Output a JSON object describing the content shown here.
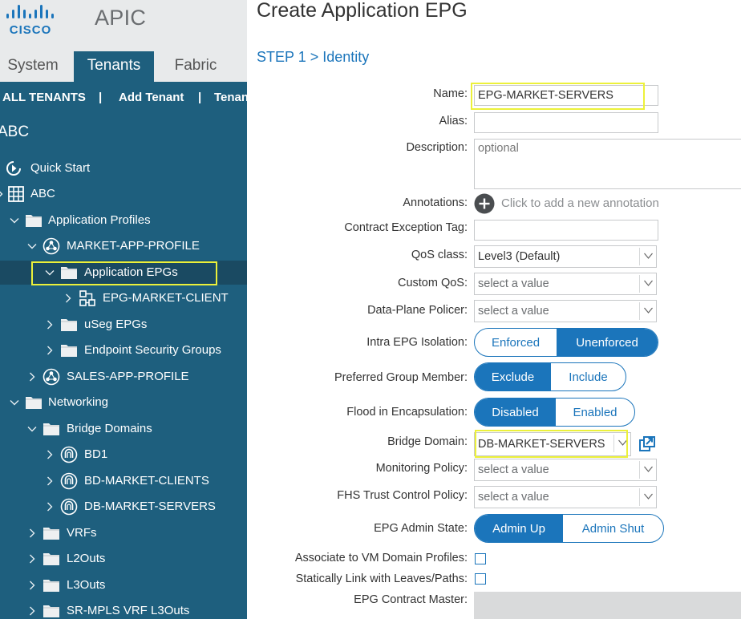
{
  "brand": {
    "logo_text": "CISCO",
    "app_name": "APIC"
  },
  "nav_tabs": {
    "system": "System",
    "tenants": "Tenants",
    "fabric": "Fabric"
  },
  "sub_nav": {
    "all_tenants": "ALL TENANTS",
    "separator": "|",
    "add_tenant": "Add Tenant",
    "tenant_search": "Tenan"
  },
  "tenant_title": "ABC",
  "tree": [
    {
      "label": "Quick Start",
      "icon": "quick-start-icon"
    },
    {
      "label": "ABC",
      "icon": "tenant-icon"
    },
    {
      "label": "Application Profiles",
      "icon": "folder-icon"
    },
    {
      "label": "MARKET-APP-PROFILE",
      "icon": "app-profile-icon"
    },
    {
      "label": "Application EPGs",
      "icon": "folder-icon",
      "selected": true
    },
    {
      "label": "EPG-MARKET-CLIENT",
      "icon": "epg-icon"
    },
    {
      "label": "uSeg EPGs",
      "icon": "folder-icon"
    },
    {
      "label": "Endpoint Security Groups",
      "icon": "folder-icon"
    },
    {
      "label": "SALES-APP-PROFILE",
      "icon": "app-profile-icon"
    },
    {
      "label": "Networking",
      "icon": "folder-icon"
    },
    {
      "label": "Bridge Domains",
      "icon": "folder-icon"
    },
    {
      "label": "BD1",
      "icon": "bridge-domain-icon"
    },
    {
      "label": "BD-MARKET-CLIENTS",
      "icon": "bridge-domain-icon"
    },
    {
      "label": "DB-MARKET-SERVERS",
      "icon": "bridge-domain-icon"
    },
    {
      "label": "VRFs",
      "icon": "folder-icon"
    },
    {
      "label": "L2Outs",
      "icon": "folder-icon"
    },
    {
      "label": "L3Outs",
      "icon": "folder-icon"
    },
    {
      "label": "SR-MPLS VRF L3Outs",
      "icon": "folder-icon"
    }
  ],
  "form": {
    "title": "Create Application EPG",
    "step": "STEP 1 > Identity",
    "name": {
      "label": "Name:",
      "value": "EPG-MARKET-SERVERS"
    },
    "alias": {
      "label": "Alias:",
      "value": ""
    },
    "description": {
      "label": "Description:",
      "placeholder": "optional"
    },
    "annotations": {
      "label": "Annotations:",
      "hint": "Click to add a new annotation"
    },
    "contract_exception_tag": {
      "label": "Contract Exception Tag:",
      "value": ""
    },
    "qos_class": {
      "label": "QoS class:",
      "value": "Level3 (Default)"
    },
    "custom_qos": {
      "label": "Custom QoS:",
      "value": "select a value"
    },
    "data_plane_policer": {
      "label": "Data-Plane Policer:",
      "value": "select a value"
    },
    "intra_epg_isolation": {
      "label": "Intra EPG Isolation:",
      "options": [
        "Enforced",
        "Unenforced"
      ],
      "selected": "Unenforced"
    },
    "preferred_group_member": {
      "label": "Preferred Group Member:",
      "options": [
        "Exclude",
        "Include"
      ],
      "selected": "Exclude"
    },
    "flood_in_encapsulation": {
      "label": "Flood in Encapsulation:",
      "options": [
        "Disabled",
        "Enabled"
      ],
      "selected": "Disabled"
    },
    "bridge_domain": {
      "label": "Bridge Domain:",
      "value": "DB-MARKET-SERVERS"
    },
    "monitoring_policy": {
      "label": "Monitoring Policy:",
      "value": "select a value"
    },
    "fhs_trust_control_policy": {
      "label": "FHS Trust Control Policy:",
      "value": "select a value"
    },
    "epg_admin_state": {
      "label": "EPG Admin State:",
      "options": [
        "Admin Up",
        "Admin Shut"
      ],
      "selected": "Admin Up"
    },
    "associate_vm_domain": {
      "label": "Associate to VM Domain Profiles:",
      "checked": false
    },
    "static_link_leaves": {
      "label": "Statically Link with Leaves/Paths:",
      "checked": false
    },
    "epg_contract_master": {
      "label": "EPG Contract Master:"
    }
  },
  "colors": {
    "sidebar": "#1e5f7e",
    "selected_row": "#1a4a62",
    "accent": "#1b75bb",
    "highlight": "#ecf13a"
  }
}
